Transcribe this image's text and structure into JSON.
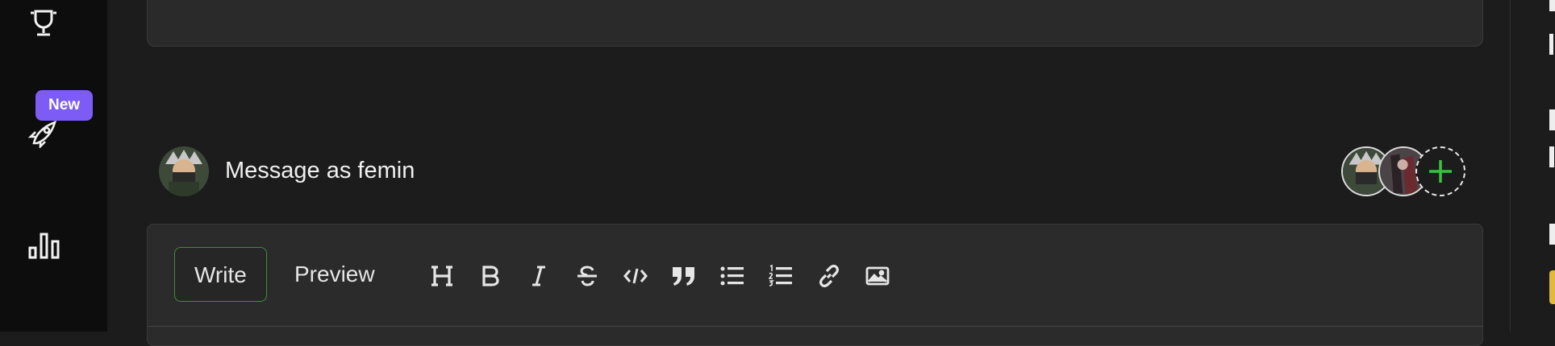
{
  "sidebar": {
    "items": [
      {
        "name": "trophy",
        "icon": "trophy-icon"
      },
      {
        "name": "launches",
        "icon": "rocket-icon",
        "badge": "New"
      },
      {
        "name": "stats",
        "icon": "bar-chart-icon"
      }
    ]
  },
  "composer": {
    "message_as": "Message as femin",
    "identities": [
      "femin",
      "other-user"
    ],
    "tabs": [
      {
        "label": "Write",
        "active": true
      },
      {
        "label": "Preview",
        "active": false
      }
    ],
    "toolbar": [
      "heading",
      "bold",
      "italic",
      "strikethrough",
      "code",
      "quote",
      "bulleted-list",
      "numbered-list",
      "link",
      "image"
    ]
  },
  "colors": {
    "accent_purple": "#7c5cf5",
    "accent_green": "#3f8a3f",
    "plus_green": "#3cc13c",
    "highlight_yellow": "#e2b93b"
  }
}
